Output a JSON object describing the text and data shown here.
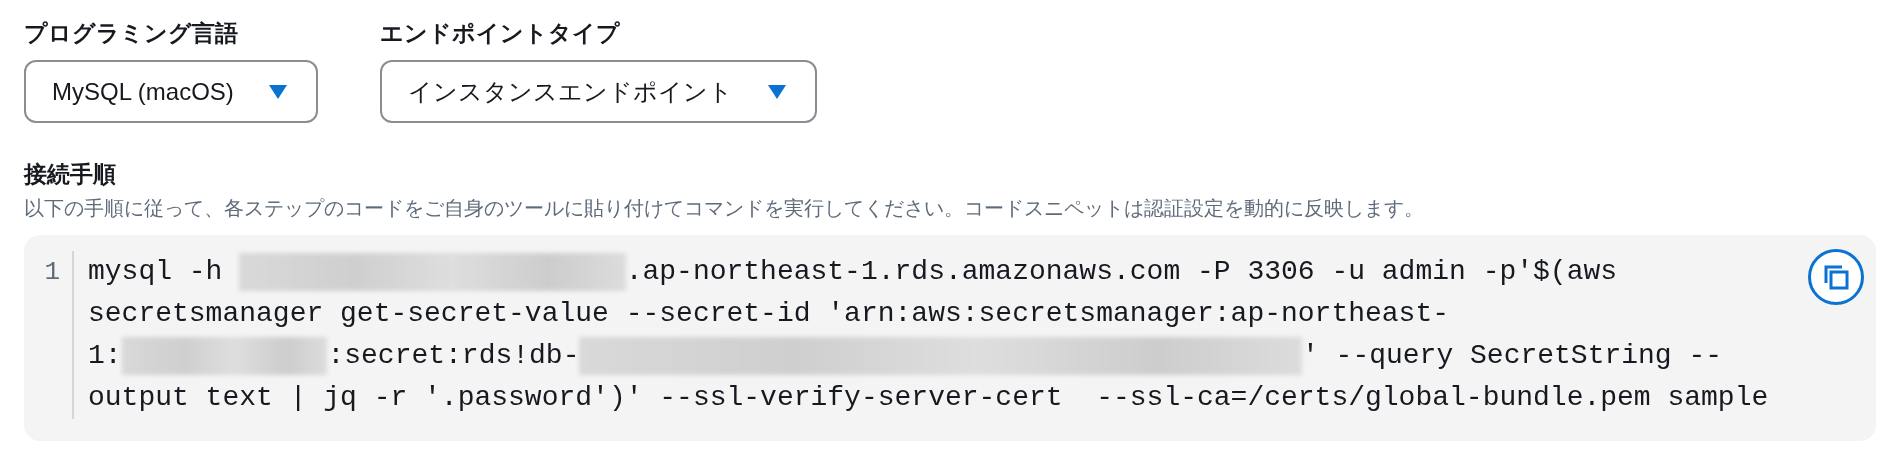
{
  "fields": [
    {
      "label": "プログラミング言語",
      "value": "MySQL (macOS)"
    },
    {
      "label": "エンドポイントタイプ",
      "value": "インスタンスエンドポイント"
    }
  ],
  "instructions": {
    "heading": "接続手順",
    "description": "以下の手順に従って、各ステップのコードをご自身のツールに貼り付けてコマンドを実行してください。コードスニペットは認証設定を動的に反映します。"
  },
  "code": {
    "line_number": "1",
    "lines": [
      {
        "parts": [
          {
            "kind": "text",
            "text": "mysql -h "
          },
          {
            "kind": "redacted"
          },
          {
            "kind": "text",
            "text": ".ap-northeast-1.rds.amazonaws.com -P 3306 -u admin -p'$(aws"
          }
        ]
      },
      {
        "parts": [
          {
            "kind": "text",
            "text": "secretsmanager get-secret-value --secret-id 'arn:aws:secretsmanager:ap-northeast-"
          }
        ]
      },
      {
        "parts": [
          {
            "kind": "text",
            "text": "1:"
          },
          {
            "kind": "redacted"
          },
          {
            "kind": "text",
            "text": ":secret:rds!db-"
          },
          {
            "kind": "redacted"
          },
          {
            "kind": "text",
            "text": "' --query SecretString --"
          }
        ]
      },
      {
        "parts": [
          {
            "kind": "text",
            "text": "output text | jq -r '.password')' --ssl-verify-server-cert  --ssl-ca=/certs/global-bundle.pem sample"
          }
        ]
      }
    ]
  }
}
